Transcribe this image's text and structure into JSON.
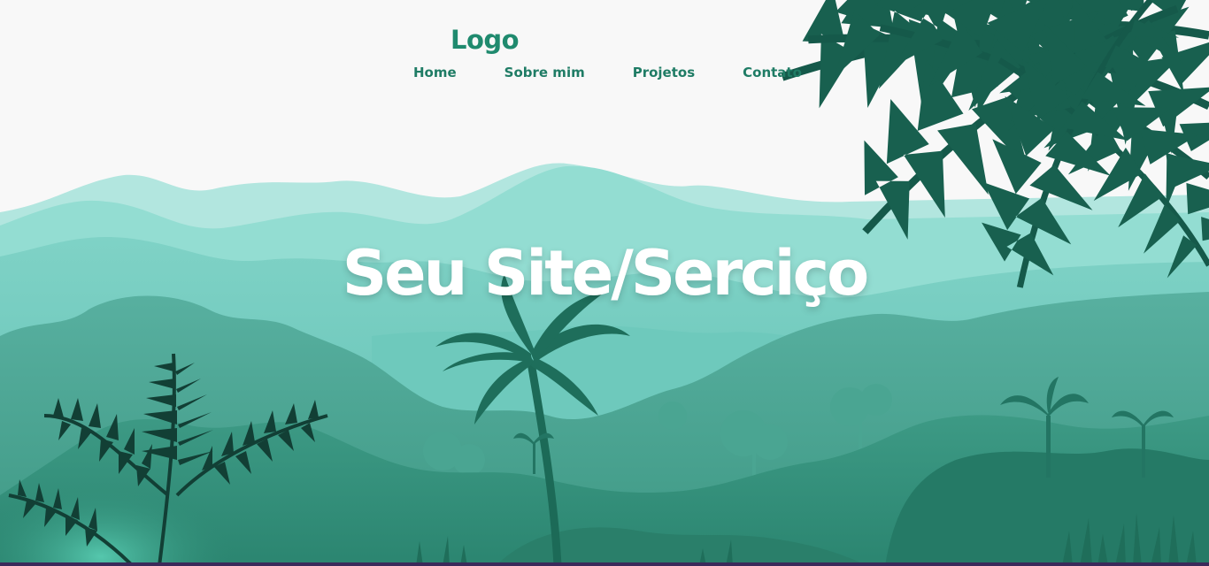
{
  "header": {
    "logo": "Logo",
    "nav": {
      "home": "Home",
      "sobre": "Sobre mim",
      "projetos": "Projetos",
      "contato": "Contato"
    }
  },
  "hero": {
    "title": "Seu Site/Serciço"
  },
  "colors": {
    "brand": "#1f8a6e",
    "nav": "#1f7c65",
    "background": "#f8f8f8",
    "fern_dark": "#16604d",
    "mountain_light": "#b2e6df",
    "mountain_mid": "#8fdad0",
    "forest": "#2f8f7a"
  },
  "icons": [
    "fern-leaf-icon",
    "palm-tree-icon",
    "tree-icon"
  ]
}
